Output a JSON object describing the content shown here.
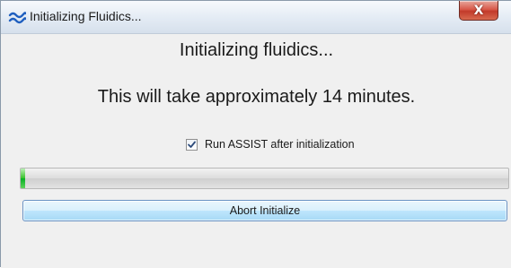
{
  "window": {
    "title": "Initializing Fluidics...",
    "icon": "fluidics-waves-icon",
    "close_glyph": "X"
  },
  "dialog": {
    "heading": "Initializing fluidics...",
    "subheading": "This will take approximately 14 minutes.",
    "checkbox": {
      "label": "Run ASSIST after initialization",
      "checked": true
    },
    "progress": {
      "fraction": 0.01
    },
    "abort_label": "Abort Initialize"
  },
  "colors": {
    "progress_fill": "#06b025",
    "icon_blue": "#1f5fbf",
    "close_red": "#c23a2a"
  }
}
